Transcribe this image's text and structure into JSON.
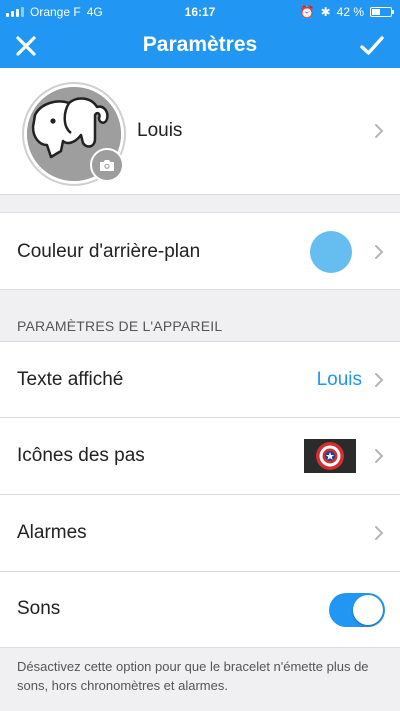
{
  "status_bar": {
    "carrier": "Orange F",
    "network": "4G",
    "time": "16:17",
    "battery": "42 %",
    "battery_level": 0.42
  },
  "nav": {
    "title": "Paramètres",
    "close_icon": "close-icon",
    "done_icon": "checkmark-icon"
  },
  "profile": {
    "name": "Louis",
    "avatar_icon": "elephant-icon",
    "camera_icon": "camera-icon"
  },
  "background_color": {
    "label": "Couleur d'arrière-plan",
    "color": "#66bef0"
  },
  "device_section": {
    "header": "PARAMÈTRES DE L'APPAREIL"
  },
  "display_text": {
    "label": "Texte affiché",
    "value": "Louis"
  },
  "step_icons": {
    "label": "Icônes des pas",
    "preview_icon": "captain-shield-icon"
  },
  "alarms": {
    "label": "Alarmes"
  },
  "sounds": {
    "label": "Sons",
    "enabled": true
  },
  "footer_note": "Désactivez cette option pour que le bracelet n'émette plus de sons, hors chronomètres et alarmes.",
  "colors": {
    "accent": "#2196f3",
    "background": "#f0f0f2"
  }
}
